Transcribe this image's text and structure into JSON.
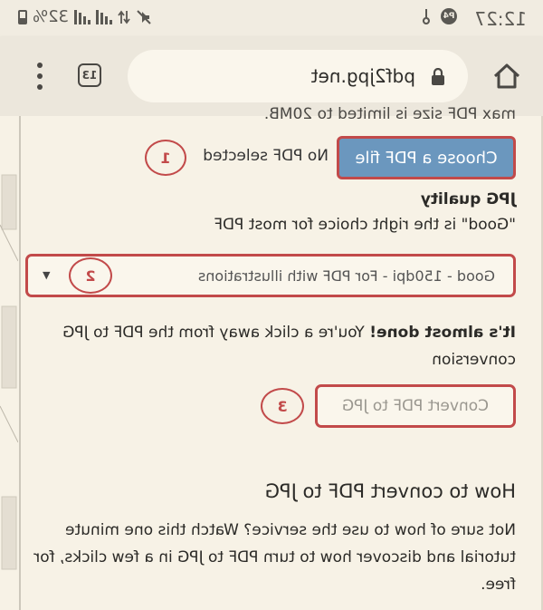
{
  "status_bar": {
    "time": "12:27",
    "battery": "32%",
    "badge": "P4"
  },
  "browser": {
    "url": "pdf2jpg.net",
    "tab_count": "13"
  },
  "page": {
    "clipped_text": "max PDF size is limited to 20MB.",
    "choose_button": "Choose a PDF file",
    "no_file_text": "No PDF selected",
    "step1": "1",
    "quality_title": "JPG quality",
    "quality_sub": "\"Good\" is the right choice for most PDF",
    "quality_selected": "Good - 150dpi - For PDF with illustrations",
    "step2": "2",
    "almost_bold": "It's almost done!",
    "almost_rest": " You're a click away from the PDF to JPG conversion",
    "convert_button": "Convert PDF to JPG",
    "step3": "3",
    "howto_title": "How to convert PDF to JPG",
    "howto_text": "Not sure of how to use the service? Watch this one minute tutorial and discover how to turn PDF to JPG in a few clicks, for free."
  }
}
